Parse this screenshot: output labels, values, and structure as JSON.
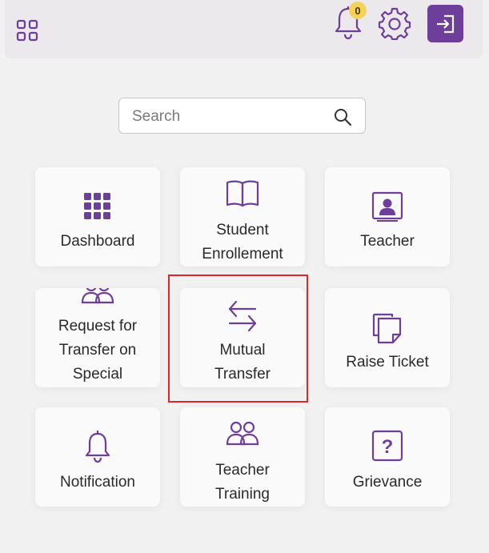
{
  "header": {
    "notification_count": "0"
  },
  "search": {
    "placeholder": "Search"
  },
  "tiles": [
    {
      "label": "Dashboard",
      "icon": "grid-icon"
    },
    {
      "label": "Student Enrollement",
      "line1": "Student",
      "line2": "Enrollement",
      "icon": "book-icon"
    },
    {
      "label": "Teacher",
      "icon": "teacher-icon"
    },
    {
      "label": "Request for Transfer on Special",
      "line1": "Request for",
      "line2": "Transfer on",
      "line3": "Special",
      "icon": "people-icon"
    },
    {
      "label": "Mutual Transfer",
      "line1": "Mutual",
      "line2": "Transfer",
      "icon": "arrows-swap-icon"
    },
    {
      "label": "Raise Ticket",
      "icon": "ticket-icon"
    },
    {
      "label": "Notification",
      "icon": "bell-icon"
    },
    {
      "label": "Teacher Training",
      "line1": "Teacher",
      "line2": "Training",
      "icon": "people-icon"
    },
    {
      "label": "Grievance",
      "icon": "question-icon"
    }
  ],
  "colors": {
    "accent": "#6d3f9a",
    "badge": "#f3d35a",
    "highlight": "#e0262b"
  }
}
